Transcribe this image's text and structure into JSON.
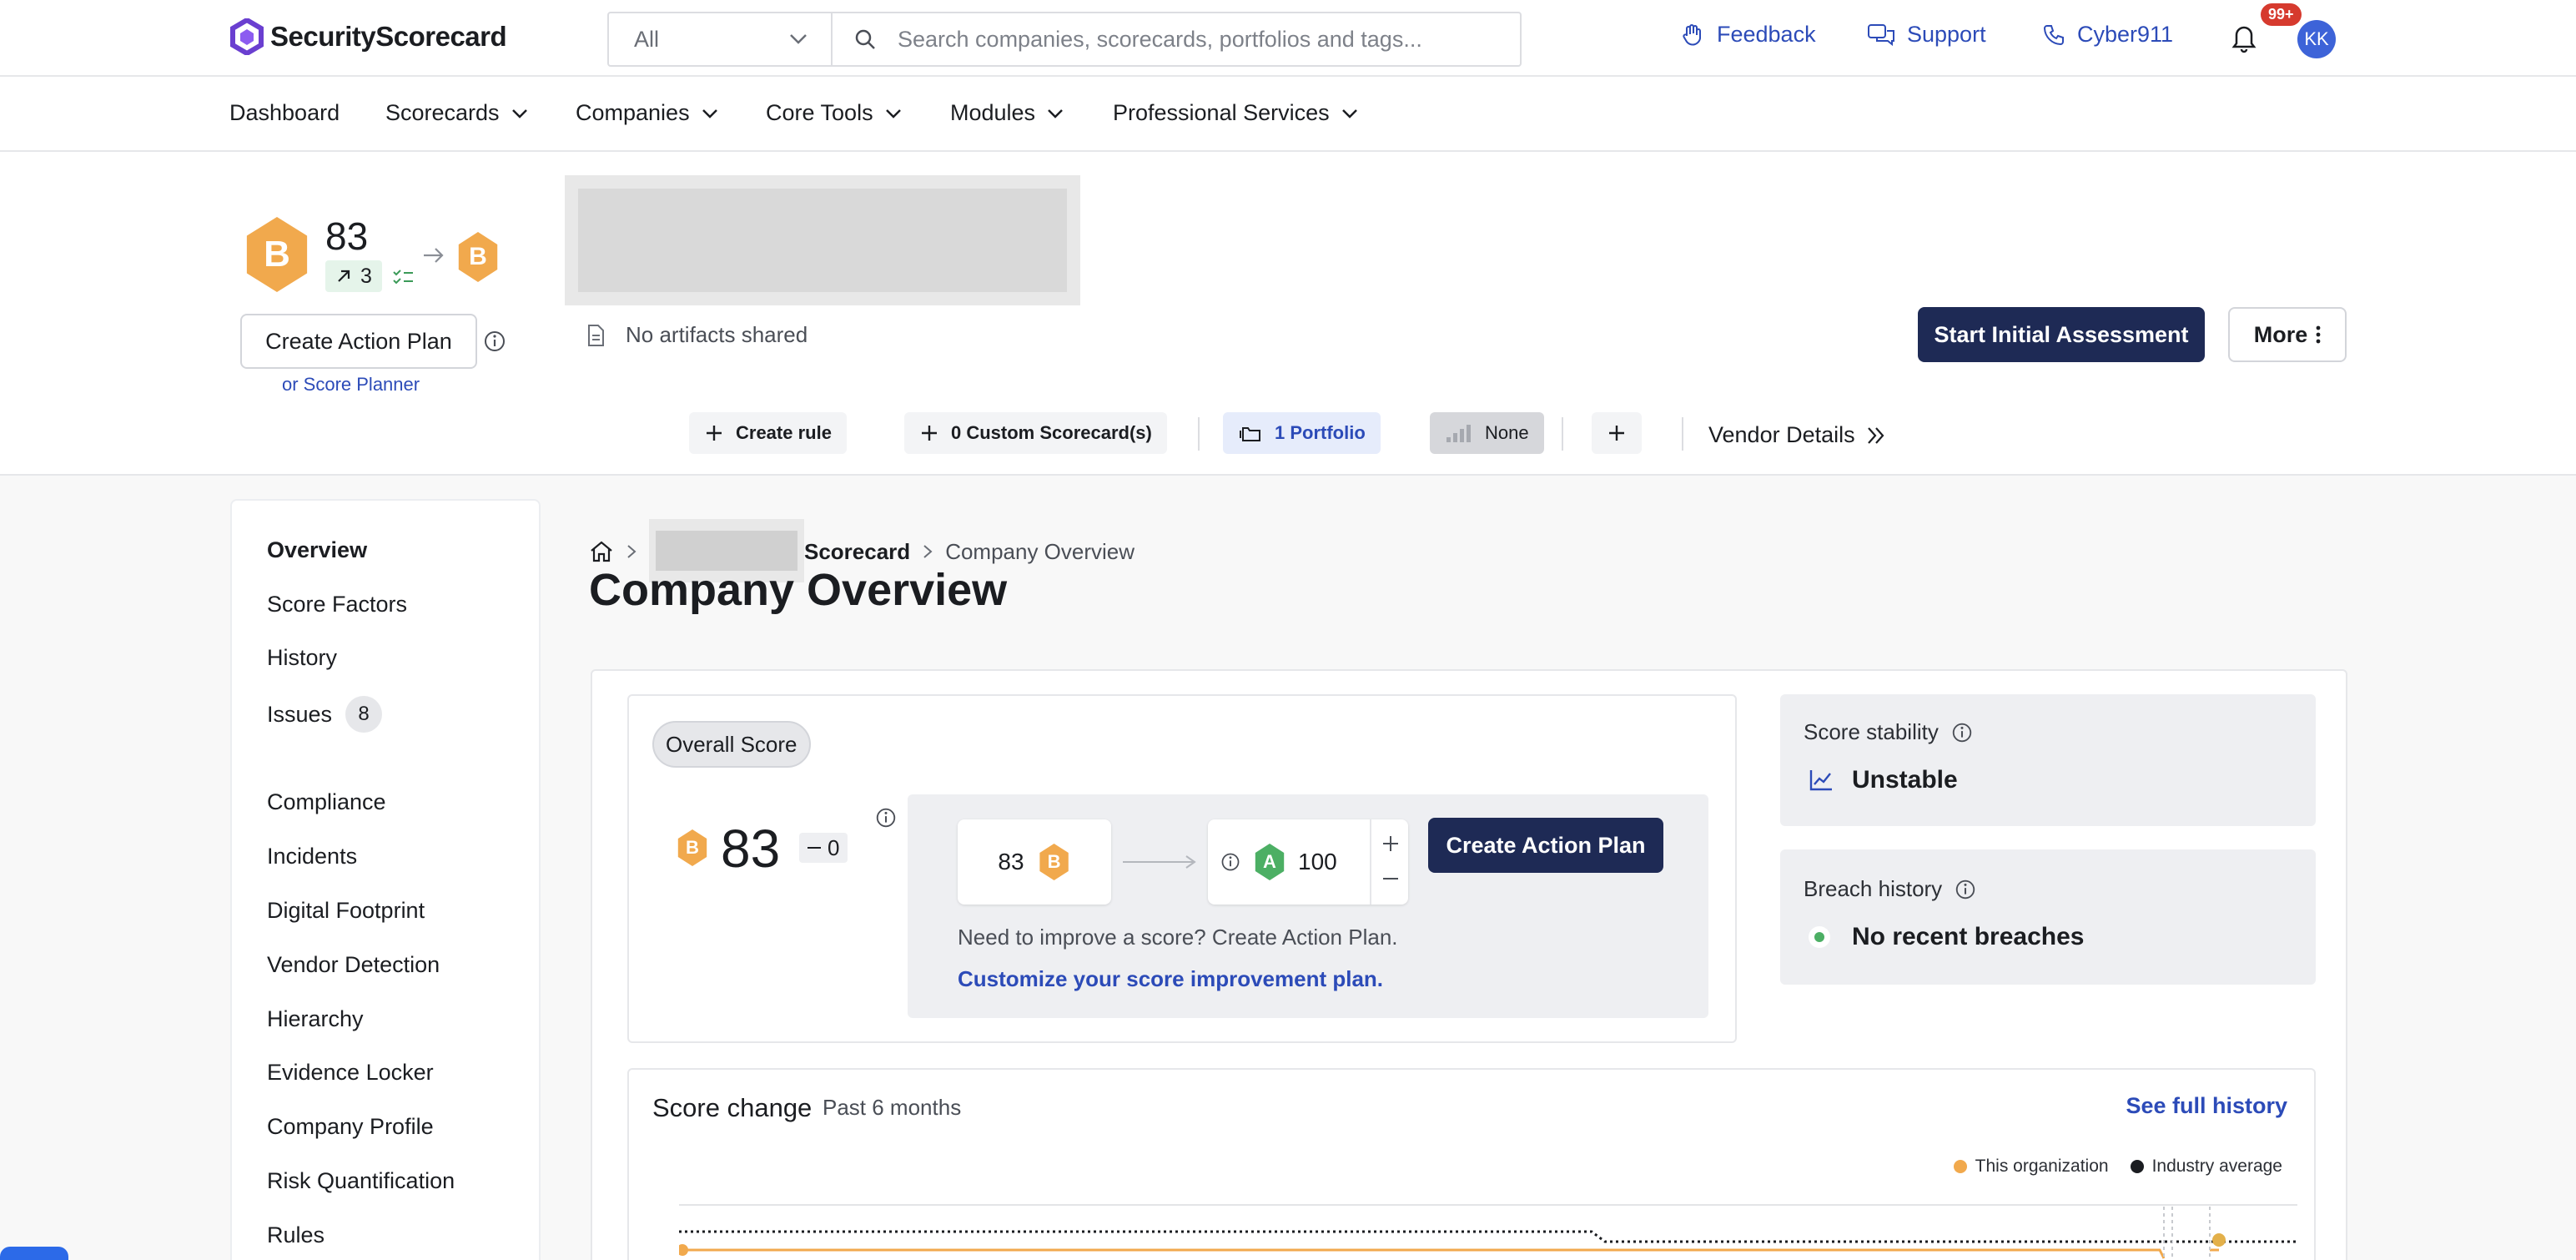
{
  "topbar": {
    "brand": "SecurityScorecard",
    "search_scope": "All",
    "search_placeholder": "Search companies, scorecards, portfolios and tags...",
    "feedback": "Feedback",
    "support": "Support",
    "cyber911": "Cyber911",
    "notification_count": "99+",
    "avatar_initials": "KK"
  },
  "nav": {
    "dashboard": "Dashboard",
    "scorecards": "Scorecards",
    "companies": "Companies",
    "core_tools": "Core Tools",
    "modules": "Modules",
    "professional_services": "Professional Services"
  },
  "header": {
    "grade": "B",
    "score": "83",
    "trend_value": "3",
    "projected_grade": "B",
    "create_action_plan": "Create Action Plan",
    "score_planner": "or Score Planner",
    "no_artifacts": "No artifacts shared",
    "start_assessment": "Start Initial Assessment",
    "more": "More",
    "create_rule": "Create rule",
    "custom_scorecards": "0 Custom Scorecard(s)",
    "portfolio": "1 Portfolio",
    "tier": "None",
    "vendor_details": "Vendor Details"
  },
  "sidebar": {
    "items": [
      {
        "label": "Overview"
      },
      {
        "label": "Score Factors"
      },
      {
        "label": "History"
      },
      {
        "label": "Issues",
        "count": "8"
      },
      {
        "label": "Compliance"
      },
      {
        "label": "Incidents"
      },
      {
        "label": "Digital Footprint"
      },
      {
        "label": "Vendor Detection"
      },
      {
        "label": "Hierarchy"
      },
      {
        "label": "Evidence Locker"
      },
      {
        "label": "Company Profile"
      },
      {
        "label": "Risk Quantification"
      },
      {
        "label": "Rules"
      }
    ]
  },
  "breadcrumb": {
    "scorecard_suffix": "Scorecard",
    "current": "Company Overview"
  },
  "page_title": "Company Overview",
  "overall": {
    "label": "Overall Score",
    "grade": "B",
    "score": "83",
    "change": "0",
    "current_score": "83",
    "current_grade": "B",
    "target_grade": "A",
    "target_score": "100",
    "create_action_plan": "Create Action Plan",
    "improve_text": "Need to improve a score? Create Action Plan.",
    "customize_link": "Customize your score improvement plan."
  },
  "stability": {
    "label": "Score stability",
    "value": "Unstable"
  },
  "breach": {
    "label": "Breach history",
    "value": "No recent breaches"
  },
  "score_change": {
    "title": "Score change",
    "period": "Past 6 months",
    "see_history": "See full history",
    "legend_org": "This organization",
    "legend_industry": "Industry average"
  },
  "colors": {
    "accent": "#2c4bb8",
    "dark_button": "#1e2a55",
    "grade_b": "#f1a94d",
    "grade_a": "#4caf64"
  }
}
